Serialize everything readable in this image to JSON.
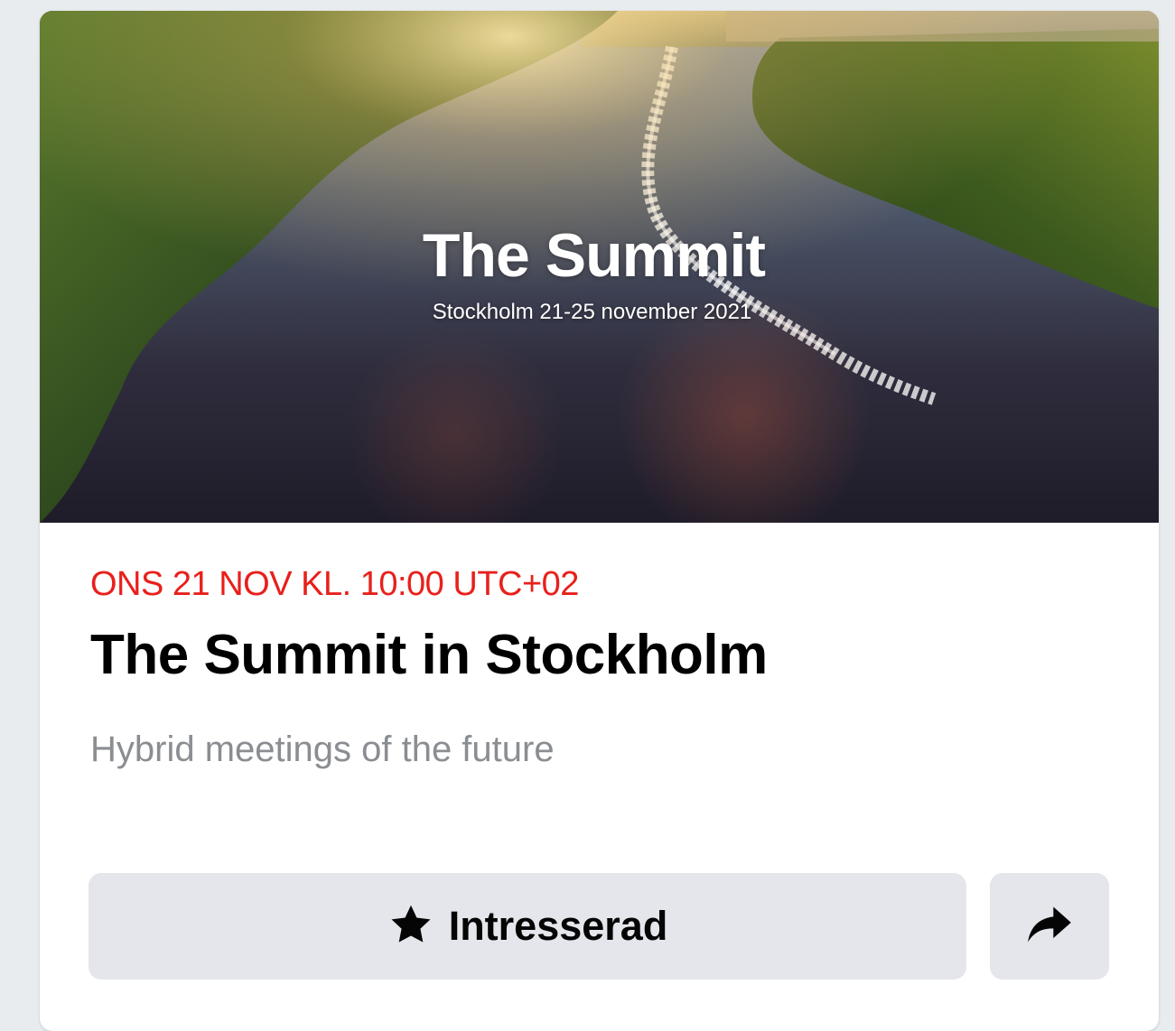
{
  "cover": {
    "title": "The Summit",
    "subtitle": "Stockholm 21-25 november 2021",
    "image_description_icon": "aerial-river-photo"
  },
  "event": {
    "date_line": "ONS 21 NOV KL. 10:00 UTC+02",
    "title": "The Summit in Stockholm",
    "subtitle": "Hybrid meetings of the future"
  },
  "actions": {
    "interested_label": "Intresserad",
    "interested_icon": "star-icon",
    "share_icon": "share-arrow-icon"
  },
  "colors": {
    "date_accent": "#e8201b",
    "button_bg": "#e4e6eb",
    "page_bg": "#e9ecef"
  }
}
